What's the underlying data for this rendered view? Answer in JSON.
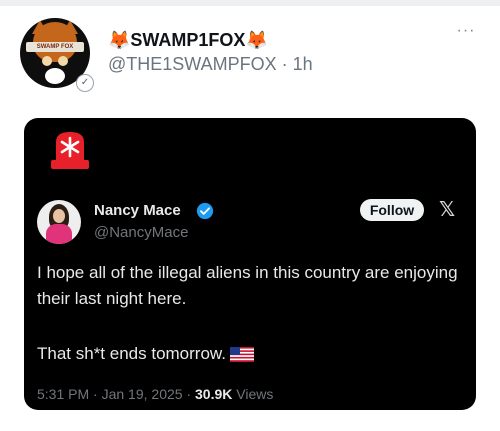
{
  "post": {
    "author_name": "SWAMP1FOX",
    "name_emoji_left": "🦊",
    "name_emoji_right": "🦊",
    "handle": "@THE1SWAMPFOX",
    "separator": "·",
    "time_ago": "1h",
    "avatar_banner_text": "SWAMP FOX",
    "more_glyph": "···"
  },
  "embedded_post": {
    "author_name": "Nancy Mace",
    "handle": "@NancyMace",
    "follow_label": "Follow",
    "x_glyph": "𝕏",
    "text_line1": "I hope all of the illegal aliens in this country are enjoying their last night here.",
    "text_line2": "That sh*t ends tomorrow.",
    "time": "5:31 PM",
    "date": "Jan 19, 2025",
    "dot": "·",
    "views_count": "30.9K",
    "views_label": "Views"
  },
  "colors": {
    "siren_red": "#e8202a",
    "verified_blue": "#1d9bf0",
    "embed_background": "#000000"
  },
  "icons": [
    "siren-icon",
    "verified-check-icon",
    "x-logo-icon",
    "us-flag-icon",
    "more-options-icon"
  ]
}
